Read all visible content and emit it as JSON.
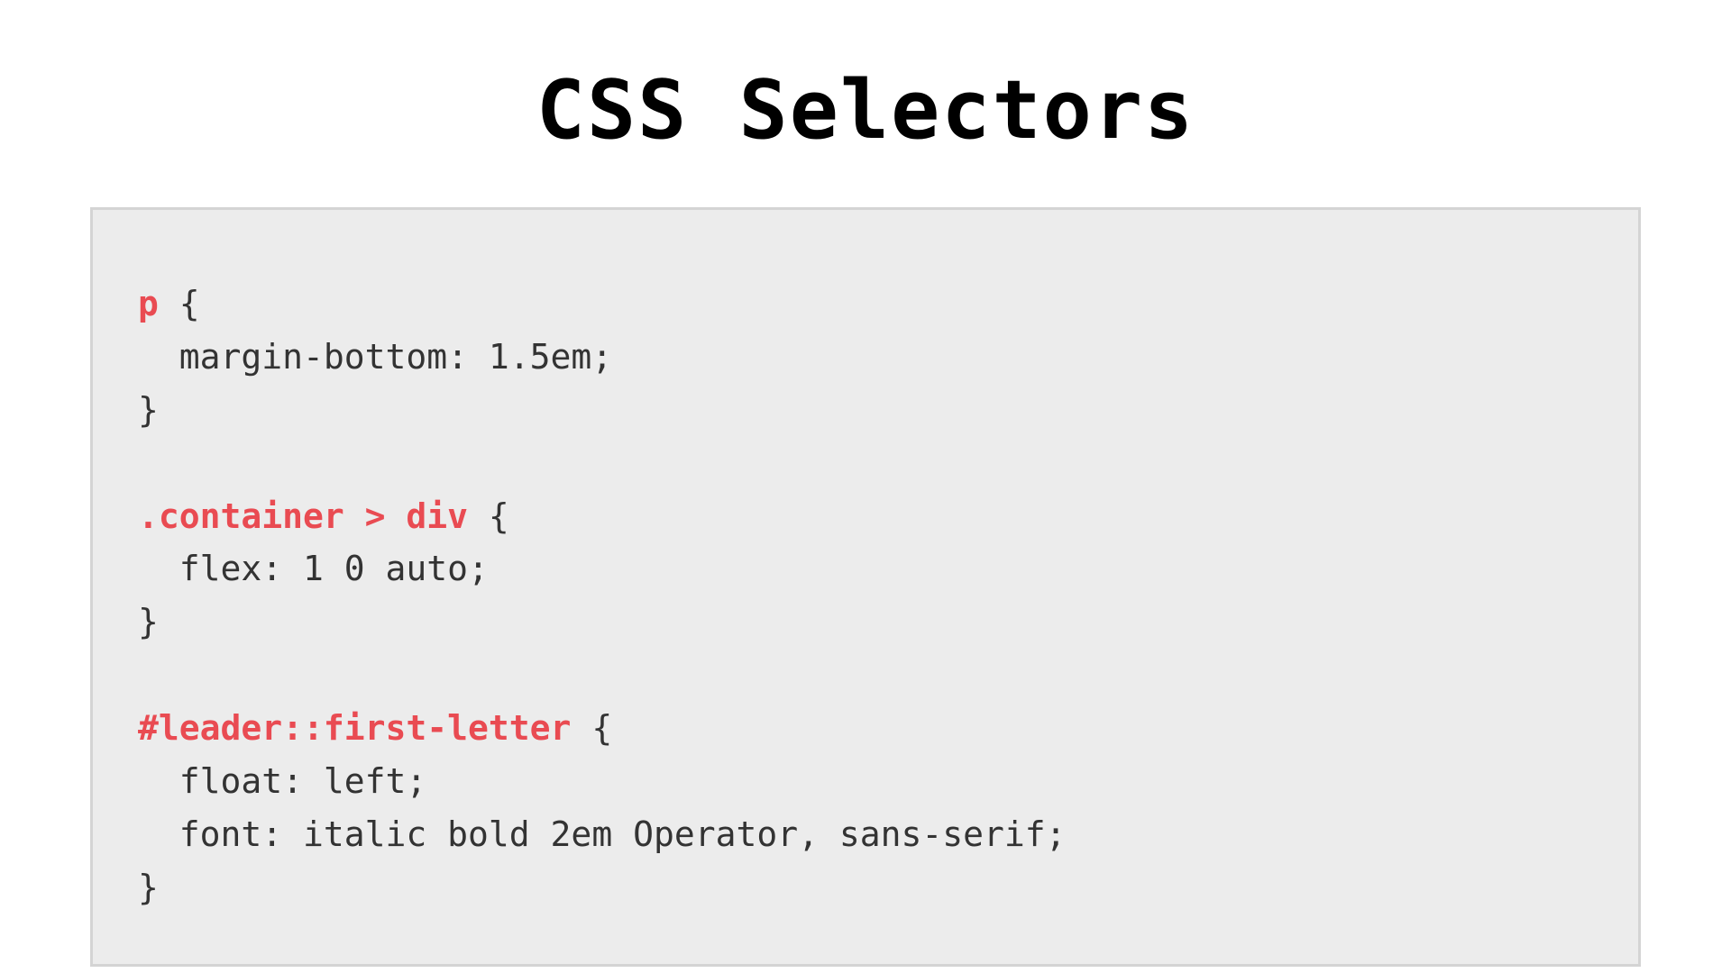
{
  "title": "CSS Selectors",
  "code": {
    "rules": [
      {
        "selector": "p",
        "open": " {",
        "declarations": [
          "  margin-bottom: 1.5em;"
        ],
        "close": "}"
      },
      {
        "selector": ".container > div",
        "open": " {",
        "declarations": [
          "  flex: 1 0 auto;"
        ],
        "close": "}"
      },
      {
        "selector": "#leader::first-letter",
        "open": " {",
        "declarations": [
          "  float: left;",
          "  font: italic bold 2em Operator, sans-serif;"
        ],
        "close": "}"
      }
    ]
  }
}
